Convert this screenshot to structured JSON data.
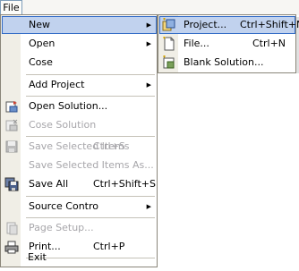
{
  "menubar": {
    "file_label": "File"
  },
  "file_menu": {
    "items": [
      {
        "label": "New",
        "shortcut": "",
        "has_submenu": true,
        "disabled": false,
        "highlighted": true,
        "icon": ""
      },
      {
        "label": "Open",
        "shortcut": "",
        "has_submenu": true,
        "disabled": false,
        "icon": ""
      },
      {
        "label": "Cose",
        "shortcut": "",
        "disabled": false,
        "icon": ""
      },
      {
        "label": "Add Project",
        "shortcut": "",
        "has_submenu": true,
        "disabled": false,
        "icon": ""
      },
      {
        "label": "Open Solution...",
        "shortcut": "",
        "disabled": false,
        "icon": "open-solution-icon"
      },
      {
        "label": "Cose Solution",
        "shortcut": "",
        "disabled": true,
        "icon": "close-solution-icon"
      },
      {
        "label": "Save Selected Items",
        "shortcut": "Ctrl+S",
        "disabled": true,
        "icon": "save-icon"
      },
      {
        "label": "Save Selected Items As...",
        "shortcut": "",
        "disabled": true,
        "icon": ""
      },
      {
        "label": "Save All",
        "shortcut": "Ctrl+Shift+S",
        "disabled": false,
        "icon": "save-all-icon"
      },
      {
        "label": "Source Contro",
        "shortcut": "",
        "has_submenu": true,
        "disabled": false,
        "icon": ""
      },
      {
        "label": "Page Setup...",
        "shortcut": "",
        "disabled": true,
        "icon": "page-setup-icon"
      },
      {
        "label": "Print...",
        "shortcut": "Ctrl+P",
        "disabled": false,
        "icon": "print-icon"
      },
      {
        "label": "Exit",
        "shortcut": "",
        "disabled": false,
        "icon": ""
      }
    ]
  },
  "new_submenu": {
    "items": [
      {
        "label": "Project...",
        "shortcut": "Ctrl+Shift+N",
        "highlighted": true,
        "icon": "new-project-icon"
      },
      {
        "label": "File...",
        "shortcut": "Ctrl+N",
        "icon": "new-file-icon"
      },
      {
        "label": "Blank Solution...",
        "shortcut": "",
        "icon": "blank-solution-icon"
      }
    ]
  },
  "colors": {
    "highlight_bg": "#c1d2ee",
    "highlight_border": "#316ac5",
    "gutter": "#f0eee6",
    "disabled_text": "#a7a6aa"
  }
}
